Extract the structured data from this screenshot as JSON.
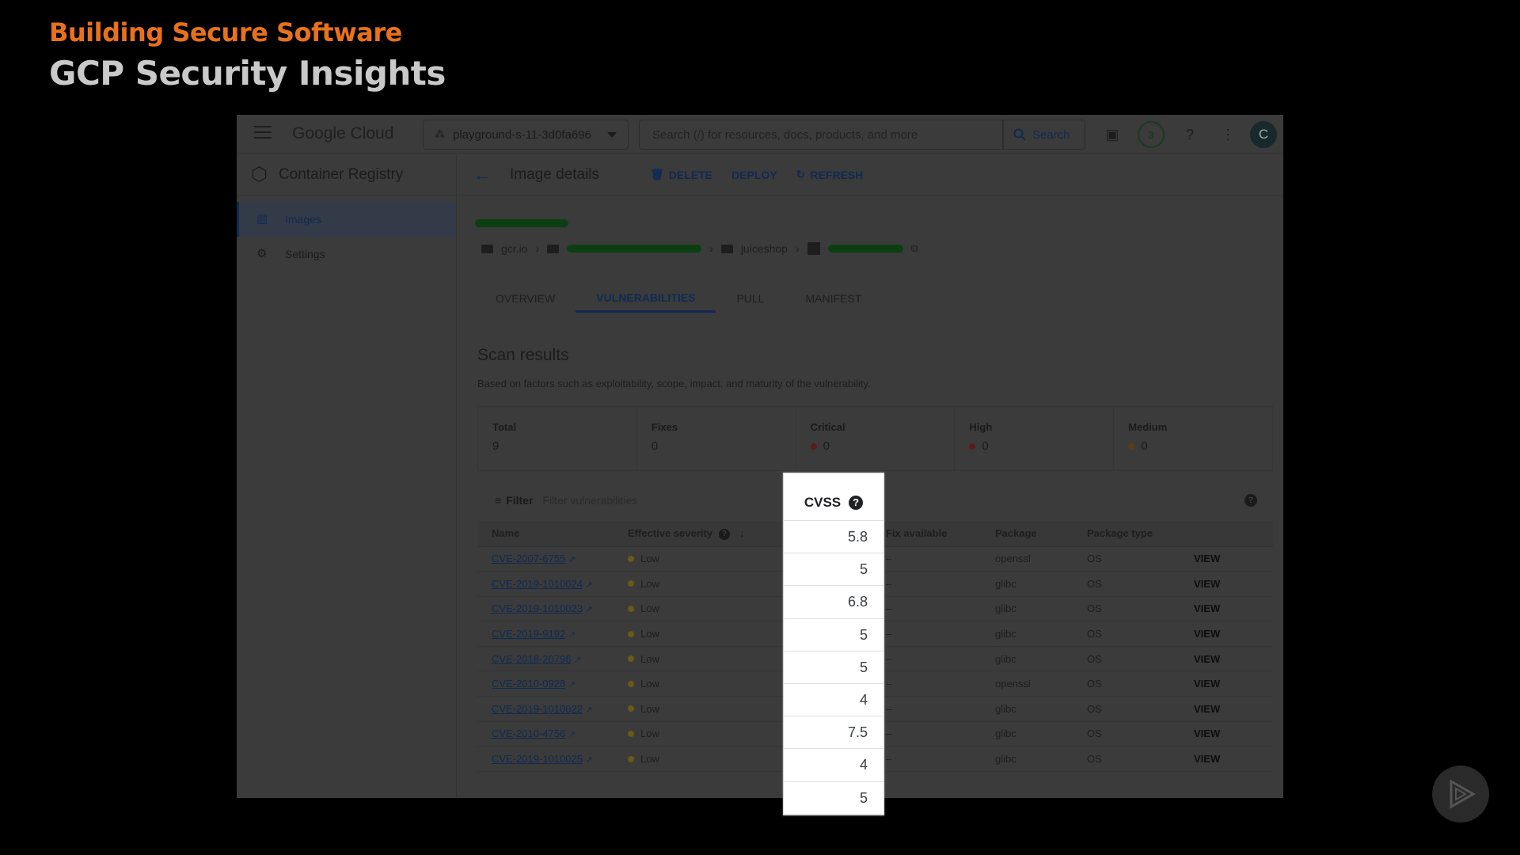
{
  "slide": {
    "title": "Building Secure Software",
    "subtitle": "GCP Security Insights"
  },
  "topbar": {
    "logo": "Google Cloud",
    "project": "playground-s-11-3d0fa696",
    "search_placeholder": "Search (/) for resources, docs, products, and more",
    "search_button": "Search",
    "notifications_count": "3",
    "avatar_initial": "C"
  },
  "sidebar": {
    "title": "Container Registry",
    "items": [
      {
        "label": "Images",
        "icon": "list-icon"
      },
      {
        "label": "Settings",
        "icon": "gear-icon"
      }
    ]
  },
  "actionbar": {
    "title": "Image details",
    "delete": "DELETE",
    "deploy": "DEPLOY",
    "refresh": "REFRESH"
  },
  "breadcrumb": {
    "registry": "gcr.io",
    "repo": "juiceshop"
  },
  "tabs": [
    "OVERVIEW",
    "VULNERABILITIES",
    "PULL",
    "MANIFEST"
  ],
  "scan": {
    "title": "Scan results",
    "description": "Based on factors such as exploitability, scope, impact, and maturity of the vulnerability.",
    "summary": [
      {
        "label": "Total",
        "value": "9"
      },
      {
        "label": "Fixes",
        "value": "0"
      },
      {
        "label": "Critical",
        "value": "0",
        "dot": "#5a1a1a"
      },
      {
        "label": "High",
        "value": "0",
        "dot": "#5a1a1a"
      },
      {
        "label": "Medium",
        "value": "0",
        "dot": "#5a3d10"
      }
    ]
  },
  "filter": {
    "label": "Filter",
    "placeholder": "Filter vulnerabilities"
  },
  "table": {
    "headers": [
      "Name",
      "Effective severity",
      "Fix available",
      "Package",
      "Package type"
    ],
    "rows": [
      {
        "name": "CVE-2007-6755",
        "severity": "Low",
        "fix": "–",
        "package": "openssl",
        "type": "OS",
        "action": "VIEW"
      },
      {
        "name": "CVE-2019-1010024",
        "severity": "Low",
        "fix": "–",
        "package": "glibc",
        "type": "OS",
        "action": "VIEW"
      },
      {
        "name": "CVE-2019-1010023",
        "severity": "Low",
        "fix": "–",
        "package": "glibc",
        "type": "OS",
        "action": "VIEW"
      },
      {
        "name": "CVE-2019-9192",
        "severity": "Low",
        "fix": "–",
        "package": "glibc",
        "type": "OS",
        "action": "VIEW"
      },
      {
        "name": "CVE-2018-20796",
        "severity": "Low",
        "fix": "–",
        "package": "glibc",
        "type": "OS",
        "action": "VIEW"
      },
      {
        "name": "CVE-2010-0928",
        "severity": "Low",
        "fix": "–",
        "package": "openssl",
        "type": "OS",
        "action": "VIEW"
      },
      {
        "name": "CVE-2019-1010022",
        "severity": "Low",
        "fix": "–",
        "package": "glibc",
        "type": "OS",
        "action": "VIEW"
      },
      {
        "name": "CVE-2010-4756",
        "severity": "Low",
        "fix": "–",
        "package": "glibc",
        "type": "OS",
        "action": "VIEW"
      },
      {
        "name": "CVE-2019-1010025",
        "severity": "Low",
        "fix": "–",
        "package": "glibc",
        "type": "OS",
        "action": "VIEW"
      }
    ]
  },
  "cvss": {
    "header": "CVSS",
    "values": [
      "5.8",
      "5",
      "6.8",
      "5",
      "5",
      "4",
      "7.5",
      "4",
      "5"
    ]
  },
  "colors": {
    "accent_orange": "#e8711c",
    "low_dot": "#6b5a14"
  }
}
